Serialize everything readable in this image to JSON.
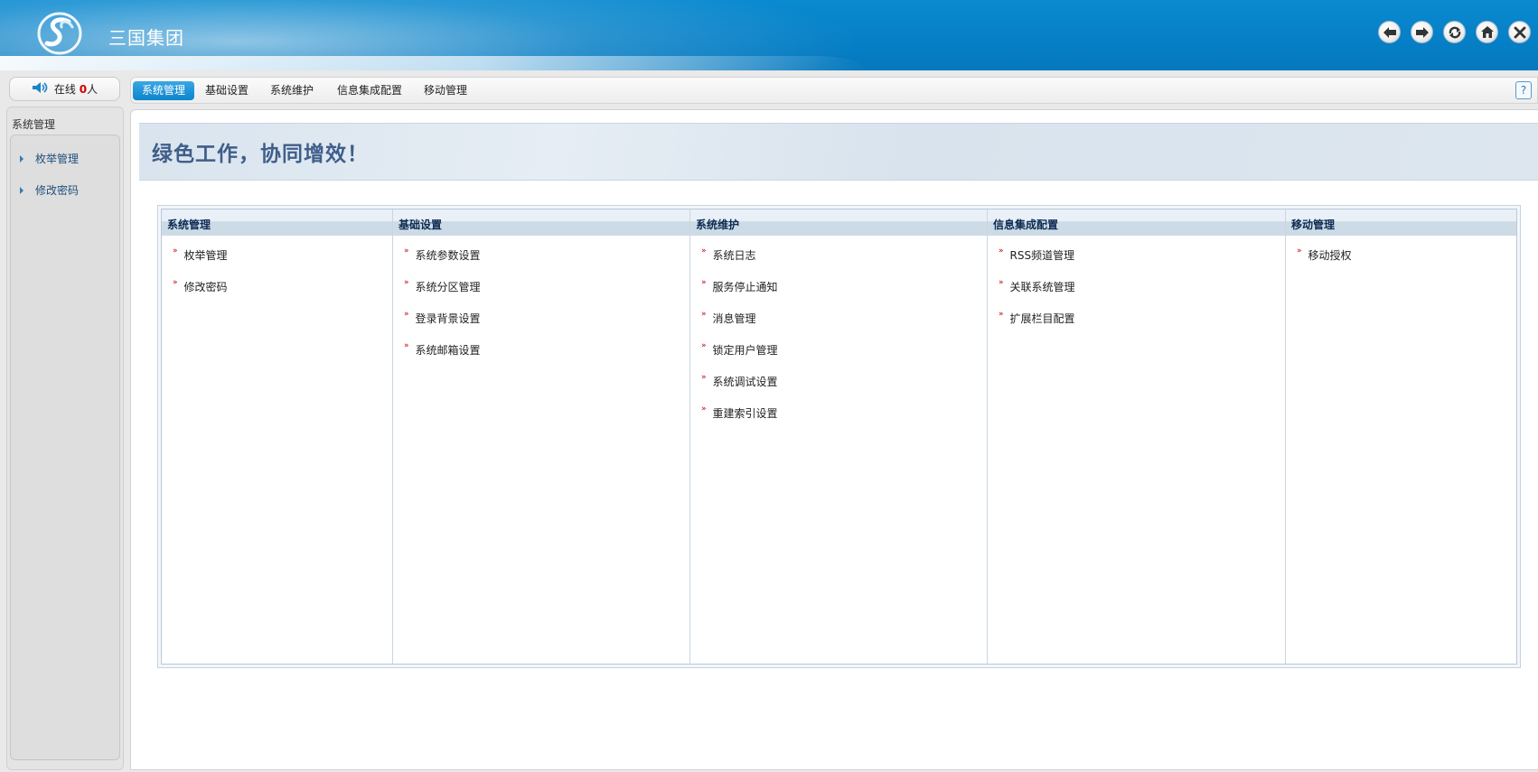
{
  "header": {
    "title": "三国集团",
    "buttons": [
      "back-icon",
      "forward-icon",
      "refresh-icon",
      "home-icon",
      "close-icon"
    ]
  },
  "online": {
    "prefix": "在线 ",
    "count": "0",
    "suffix": "人"
  },
  "sidebar": {
    "title": "系统管理",
    "items": [
      {
        "label": "枚举管理"
      },
      {
        "label": "修改密码"
      }
    ]
  },
  "tabs": [
    {
      "label": "系统管理",
      "active": true
    },
    {
      "label": "基础设置",
      "active": false
    },
    {
      "label": "系统维护",
      "active": false
    },
    {
      "label": "信息集成配置",
      "active": false
    },
    {
      "label": "移动管理",
      "active": false
    }
  ],
  "help": {
    "label": "?"
  },
  "banner": {
    "slogan": "绿色工作，协同增效！"
  },
  "columns": [
    {
      "title": "系统管理",
      "items": [
        "枚举管理",
        "修改密码"
      ]
    },
    {
      "title": "基础设置",
      "items": [
        "系统参数设置",
        "系统分区管理",
        "登录背景设置",
        "系统邮箱设置"
      ]
    },
    {
      "title": "系统维护",
      "items": [
        "系统日志",
        "服务停止通知",
        "消息管理",
        "锁定用户管理",
        "系统调试设置",
        "重建索引设置"
      ]
    },
    {
      "title": "信息集成配置",
      "items": [
        "RSS频道管理",
        "关联系统管理",
        "扩展栏目配置"
      ]
    },
    {
      "title": "移动管理",
      "items": [
        "移动授权"
      ]
    }
  ],
  "colors": {
    "header": "#0a8ad0",
    "active_tab": "#0c84cc",
    "banner_text": "#3f5e8a"
  }
}
